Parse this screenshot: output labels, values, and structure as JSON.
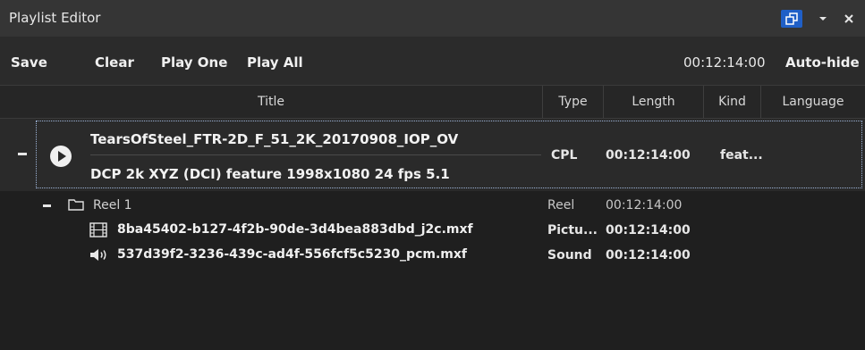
{
  "window": {
    "title": "Playlist Editor",
    "icons": {
      "undock": "undock-icon",
      "menu": "dropdown-icon",
      "close": "close-icon"
    },
    "accent_color": "#1f5fc7"
  },
  "toolbar": {
    "save_label": "Save",
    "clear_label": "Clear",
    "play_one_label": "Play One",
    "play_all_label": "Play All",
    "timecode": "00:12:14:00",
    "autohide_label": "Auto-hide"
  },
  "columns": {
    "title": "Title",
    "type": "Type",
    "length": "Length",
    "kind": "Kind",
    "language": "Language"
  },
  "cpl": {
    "name": "TearsOfSteel_FTR-2D_F_51_2K_20170908_IOP_OV",
    "meta": "DCP 2k  XYZ (DCI)  feature  1998x1080  24 fps  5.1",
    "type": "CPL",
    "length": "00:12:14:00",
    "kind": "feat...",
    "language": "",
    "icons": {
      "toggle": "collapse-icon",
      "play": "play-icon"
    }
  },
  "reel": {
    "label": "Reel 1",
    "type": "Reel",
    "length": "00:12:14:00",
    "icons": {
      "toggle": "collapse-icon",
      "folder": "folder-icon"
    }
  },
  "assets": [
    {
      "name": "8ba45402-b127-4f2b-90de-3d4bea883dbd_j2c.mxf",
      "type": "Pictu...",
      "length": "00:12:14:00",
      "icon": "film-icon"
    },
    {
      "name": "537d39f2-3236-439c-ad4f-556fcf5c5230_pcm.mxf",
      "type": "Sound",
      "length": "00:12:14:00",
      "icon": "speaker-icon"
    }
  ]
}
